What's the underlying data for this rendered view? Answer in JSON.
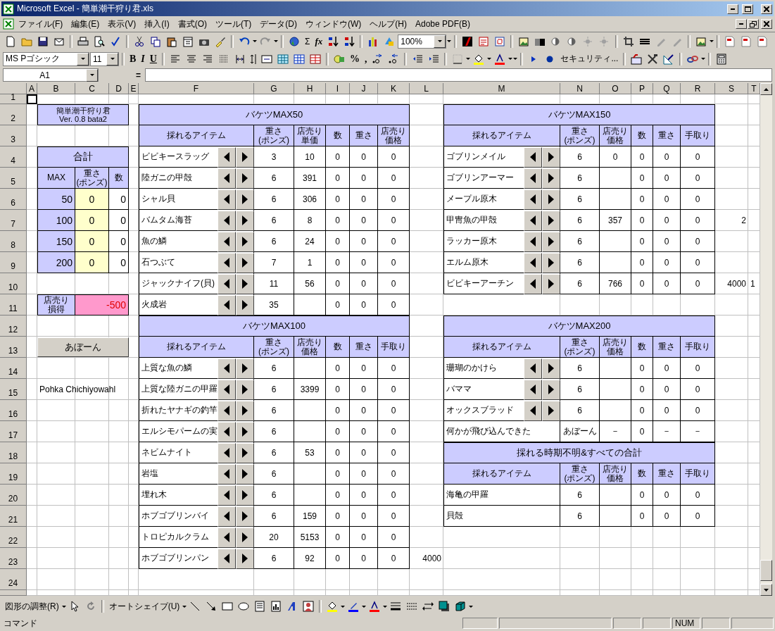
{
  "window": {
    "title": "Microsoft Excel - 簡単潮干狩り君.xls"
  },
  "menu": [
    "ファイル(F)",
    "編集(E)",
    "表示(V)",
    "挿入(I)",
    "書式(O)",
    "ツール(T)",
    "データ(D)",
    "ウィンドウ(W)",
    "ヘルプ(H)",
    "Adobe PDF(B)"
  ],
  "standard_toolbar": {
    "sum": "Σ",
    "function": "fx",
    "zoom": "100%"
  },
  "formatting_toolbar": {
    "font": "MS Pゴシック",
    "size": "11",
    "bold": "B",
    "italic": "I",
    "underline": "U",
    "percent": "%",
    "comma": ",",
    "security": "セキュリティ..."
  },
  "formula_bar": {
    "name_box": "A1",
    "equals": "="
  },
  "column_headers": [
    "A",
    "B",
    "C",
    "D",
    "E",
    "F",
    "G",
    "H",
    "I",
    "J",
    "K",
    "L",
    "M",
    "N",
    "O",
    "P",
    "Q",
    "R",
    "S",
    "T"
  ],
  "row_headers": [
    "1",
    "2",
    "3",
    "4",
    "5",
    "6",
    "7",
    "8",
    "9",
    "10",
    "11",
    "12",
    "13",
    "14",
    "15",
    "16",
    "17",
    "18",
    "19",
    "20",
    "21",
    "22",
    "23",
    "24"
  ],
  "sheet": {
    "title": [
      "簡単潮干狩り君",
      "Ver. 0.8 bata2"
    ],
    "summary": {
      "title": "合計",
      "headers": [
        "MAX",
        "重さ\n(ポンズ)",
        "数"
      ],
      "rows": [
        [
          "50",
          "0",
          "0"
        ],
        [
          "100",
          "0",
          "0"
        ],
        [
          "150",
          "0",
          "0"
        ],
        [
          "200",
          "0",
          "0"
        ]
      ],
      "profit": {
        "label": "店売り損得",
        "value": "-500"
      }
    },
    "button": "あぼーん",
    "author": "Pohka Chichiyowahl",
    "buckets": [
      {
        "title": "バケツMAX50",
        "headers": [
          "採れるアイテム",
          "重さ\n(ポンズ)",
          "店売り単価",
          "数",
          "重さ",
          "店売り価格"
        ],
        "rows": [
          {
            "item": "ビビキースラッグ",
            "spinner": true,
            "weight": "3",
            "price": "10",
            "count": "0",
            "total_weight": "0",
            "total": "0"
          },
          {
            "item": "陸ガニの甲殻",
            "spinner": true,
            "weight": "6",
            "price": "391",
            "count": "0",
            "total_weight": "0",
            "total": "0"
          },
          {
            "item": "シャル貝",
            "spinner": true,
            "weight": "6",
            "price": "306",
            "count": "0",
            "total_weight": "0",
            "total": "0"
          },
          {
            "item": "バムタム海苔",
            "spinner": true,
            "weight": "6",
            "price": "8",
            "count": "0",
            "total_weight": "0",
            "total": "0"
          },
          {
            "item": "魚の鱗",
            "spinner": true,
            "weight": "6",
            "price": "24",
            "count": "0",
            "total_weight": "0",
            "total": "0"
          },
          {
            "item": "石つぶて",
            "spinner": true,
            "weight": "7",
            "price": "1",
            "count": "0",
            "total_weight": "0",
            "total": "0"
          },
          {
            "item": "ジャックナイフ(貝)",
            "spinner": true,
            "weight": "11",
            "price": "56",
            "count": "0",
            "total_weight": "0",
            "total": "0"
          },
          {
            "item": "火成岩",
            "spinner": true,
            "weight": "35",
            "count": "0",
            "total_weight": "0",
            "total": "0"
          }
        ]
      },
      {
        "title": "バケツMAX100",
        "headers": [
          "採れるアイテム",
          "重さ\n(ポンズ)",
          "店売り価格",
          "数",
          "重さ",
          "手取り"
        ],
        "rows": [
          {
            "item": "上質な魚の鱗",
            "spinner": true,
            "weight": "6",
            "count": "0",
            "total_weight": "0",
            "total": "0"
          },
          {
            "item": "上質な陸ガニの甲羅",
            "spinner": true,
            "weight": "6",
            "price": "3399",
            "count": "0",
            "total_weight": "0",
            "total": "0"
          },
          {
            "item": "折れたヤナギの釣竿",
            "spinner": true,
            "weight": "6",
            "count": "0",
            "total_weight": "0",
            "total": "0"
          },
          {
            "item": "エルシモパームの実",
            "spinner": true,
            "weight": "6",
            "count": "0",
            "total_weight": "0",
            "total": "0"
          },
          {
            "item": "ネビムナイト",
            "spinner": true,
            "weight": "6",
            "price": "53",
            "count": "0",
            "total_weight": "0",
            "total": "0"
          },
          {
            "item": "岩塩",
            "spinner": true,
            "weight": "6",
            "count": "0",
            "total_weight": "0",
            "total": "0"
          },
          {
            "item": "埋れ木",
            "spinner": true,
            "weight": "6",
            "count": "0",
            "total_weight": "0",
            "total": "0"
          },
          {
            "item": "ホブゴブリンバイ",
            "spinner": true,
            "weight": "6",
            "price": "159",
            "count": "0",
            "total_weight": "0",
            "total": "0"
          },
          {
            "item": "トロピカルクラム",
            "spinner": true,
            "weight": "20",
            "price": "5153",
            "count": "0",
            "total_weight": "0",
            "total": "0"
          },
          {
            "item": "ホブゴブリンパン",
            "spinner": true,
            "weight": "6",
            "price": "92",
            "count": "0",
            "total_weight": "0",
            "total": "0"
          }
        ]
      },
      {
        "title": "バケツMAX150",
        "headers": [
          "採れるアイテム",
          "重さ\n(ポンズ)",
          "店売り価格",
          "数",
          "重さ",
          "手取り"
        ],
        "rows": [
          {
            "item": "ゴブリンメイル",
            "spinner": true,
            "weight": "6",
            "price": "0",
            "count": "0",
            "total_weight": "0",
            "total": "0"
          },
          {
            "item": "ゴブリンアーマー",
            "spinner": true,
            "weight": "6",
            "count": "0",
            "total_weight": "0",
            "total": "0"
          },
          {
            "item": "メープル原木",
            "spinner": true,
            "weight": "6",
            "count": "0",
            "total_weight": "0",
            "total": "0"
          },
          {
            "item": "甲冑魚の甲殻",
            "spinner": true,
            "weight": "6",
            "price": "357",
            "count": "0",
            "total_weight": "0",
            "total": "0"
          },
          {
            "item": "ラッカー原木",
            "spinner": true,
            "weight": "6",
            "count": "0",
            "total_weight": "0",
            "total": "0"
          },
          {
            "item": "エルム原木",
            "spinner": true,
            "weight": "6",
            "count": "0",
            "total_weight": "0",
            "total": "0"
          },
          {
            "item": "ビビキーアーチン",
            "spinner": true,
            "weight": "6",
            "price": "766",
            "count": "0",
            "total_weight": "0",
            "total": "0"
          }
        ]
      },
      {
        "title": "バケツMAX200",
        "headers": [
          "採れるアイテム",
          "重さ\n(ポンズ)",
          "店売り価格",
          "数",
          "重さ",
          "手取り"
        ],
        "rows": [
          {
            "item": "珊瑚のかけら",
            "spinner": true,
            "weight": "6",
            "count": "0",
            "total_weight": "0",
            "total": "0"
          },
          {
            "item": "バママ",
            "spinner": true,
            "weight": "6",
            "count": "0",
            "total_weight": "0",
            "total": "0"
          },
          {
            "item": "オックスブラッド",
            "spinner": true,
            "weight": "6",
            "count": "0",
            "total_weight": "0",
            "total": "0"
          },
          {
            "item": "何かが飛び込んできた",
            "spinner": false,
            "weight": "あぼーん",
            "price": "－",
            "count": "0",
            "total_weight": "－",
            "total": "－"
          }
        ]
      },
      {
        "title": "採れる時期不明&すべての合計",
        "headers": [
          "採れるアイテム",
          "重さ\n(ポンズ)",
          "店売り価格",
          "数",
          "重さ",
          "手取り"
        ],
        "rows": [
          {
            "item": "海亀の甲羅",
            "spinner": false,
            "weight": "6",
            "count": "0",
            "total_weight": "0",
            "total": "0"
          },
          {
            "item": "貝殻",
            "spinner": false,
            "weight": "6",
            "count": "0",
            "total_weight": "0",
            "total": "0"
          }
        ]
      }
    ],
    "loose_cells": [
      "2",
      "4000",
      "1",
      "4000"
    ]
  },
  "drawing_toolbar": {
    "draw": "図形の調整(R)",
    "autoshape": "オートシェイプ(U)"
  },
  "status_bar": {
    "mode": "コマンド",
    "num": "NUM"
  }
}
